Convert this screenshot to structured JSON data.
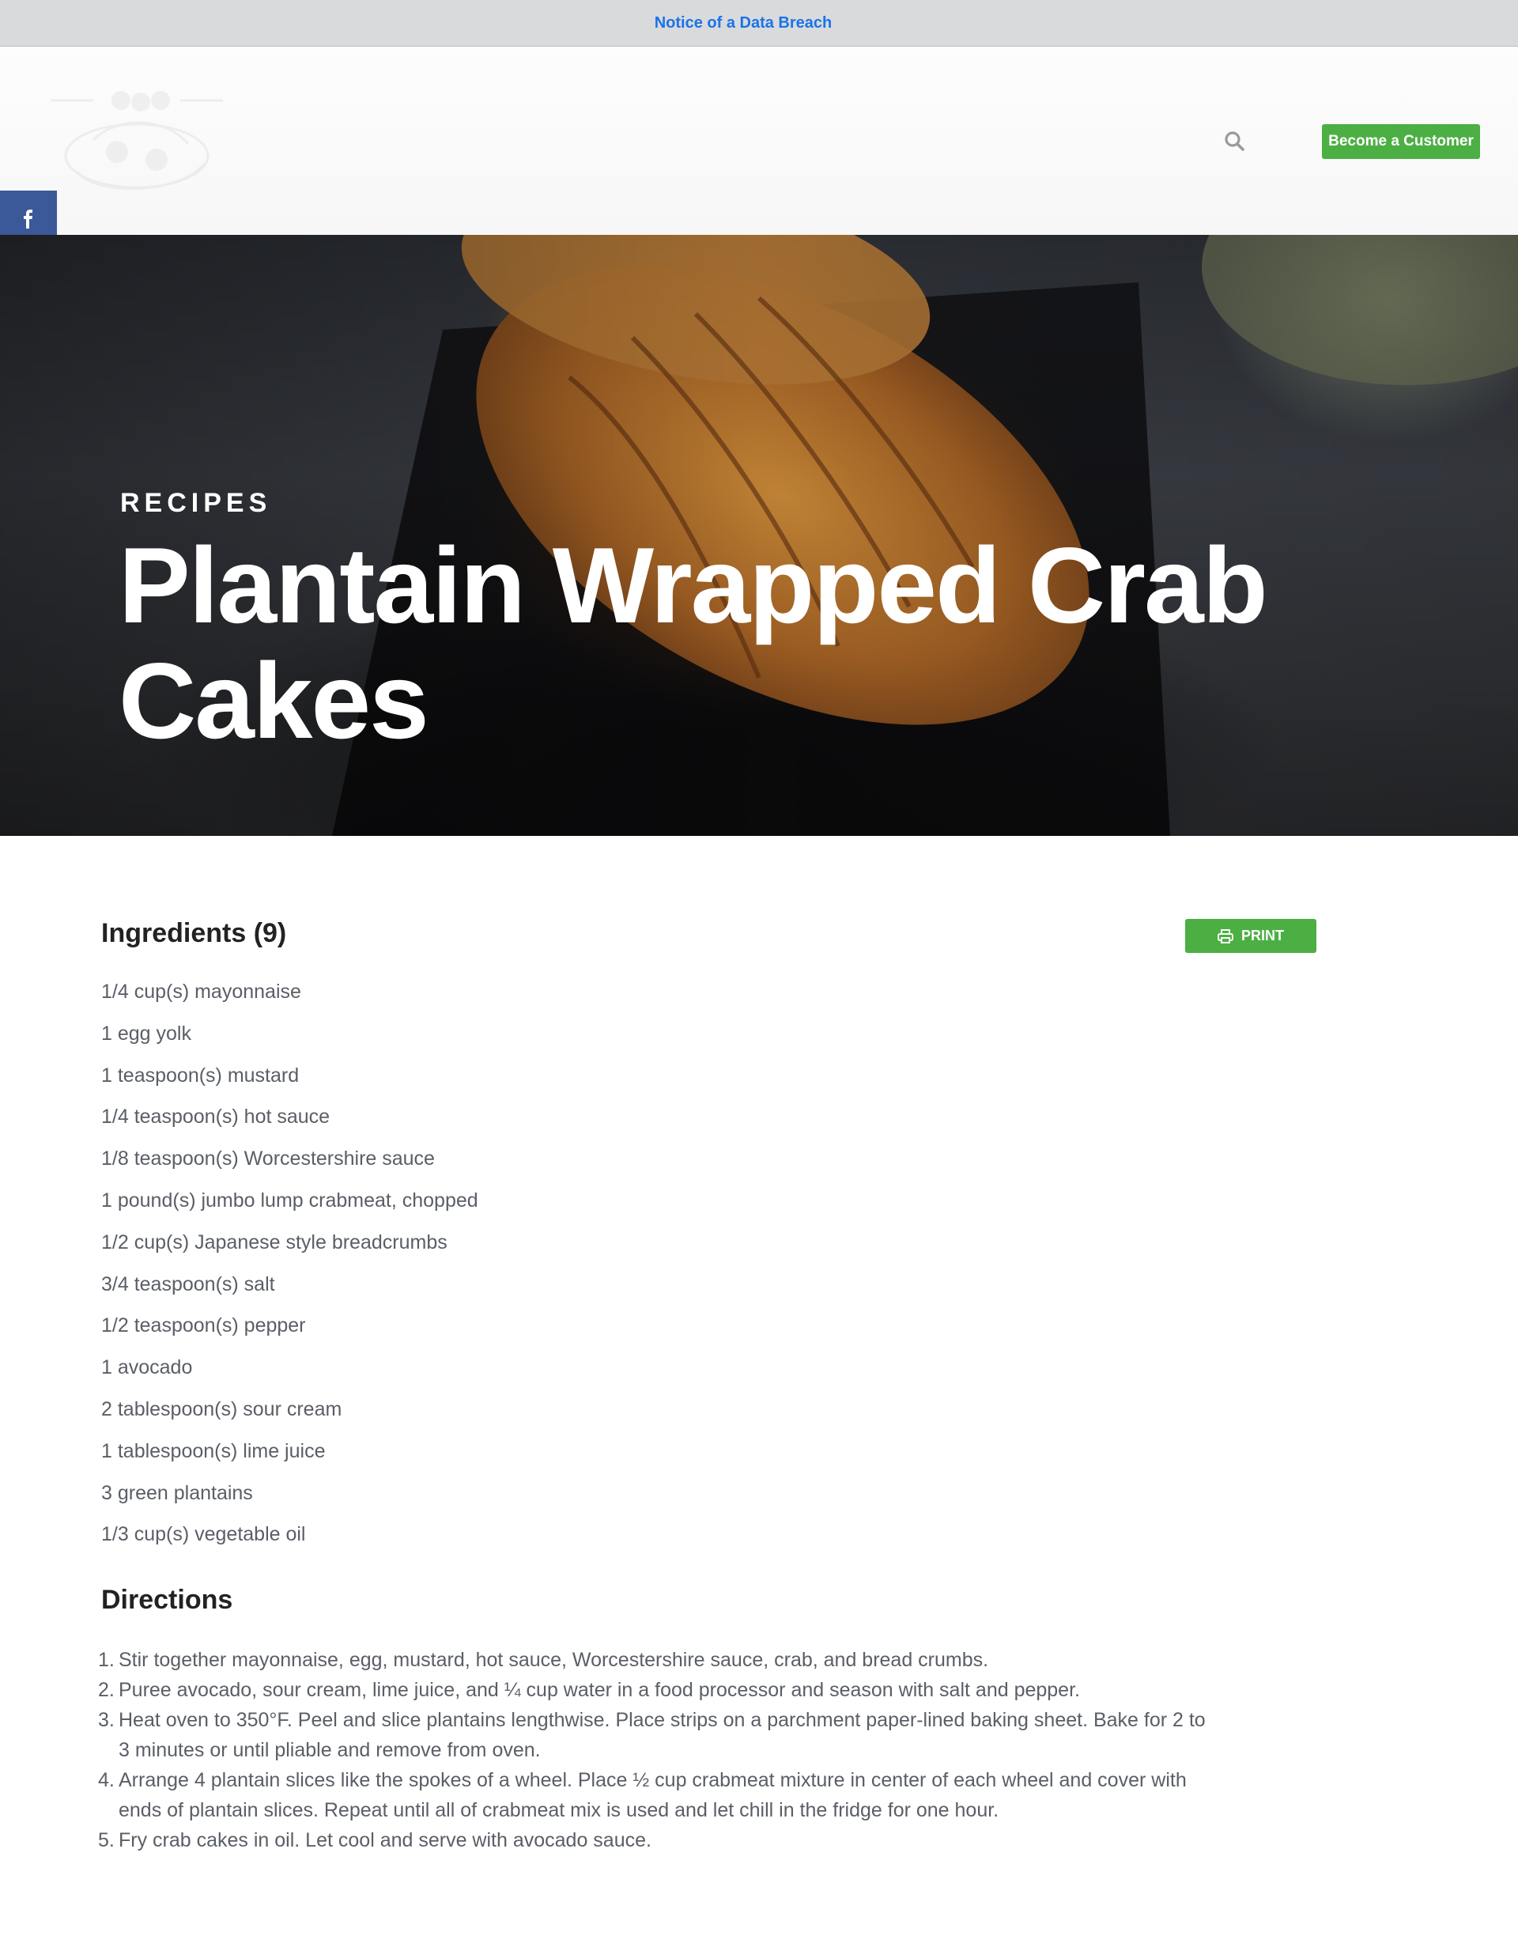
{
  "notice": {
    "text": "Notice of a Data Breach"
  },
  "header": {
    "cta_label": "Become a Customer"
  },
  "social": [
    "facebook-icon",
    "x-icon",
    "pinterest-icon",
    "email-icon",
    "share-icon"
  ],
  "hero": {
    "eyebrow": "RECIPES",
    "title": "Plantain Wrapped Crab Cakes"
  },
  "ingredients": {
    "heading": "Ingredients (9)",
    "print_label": "PRINT",
    "items": [
      "1/4 cup(s) mayonnaise",
      "1 egg yolk",
      "1 teaspoon(s) mustard",
      "1/4 teaspoon(s) hot sauce",
      "1/8 teaspoon(s) Worcestershire sauce",
      "1 pound(s) jumbo lump crabmeat, chopped",
      "1/2 cup(s) Japanese style breadcrumbs",
      "3/4 teaspoon(s) salt",
      "1/2 teaspoon(s) pepper",
      "1 avocado",
      "2 tablespoon(s) sour cream",
      "1 tablespoon(s) lime juice",
      "3 green plantains",
      "1/3 cup(s) vegetable oil"
    ]
  },
  "directions": {
    "heading": "Directions",
    "steps": [
      "Stir together mayonnaise, egg, mustard, hot sauce, Worcestershire sauce, crab, and bread crumbs.",
      "Puree avocado, sour cream, lime juice, and ¼ cup water in a food processor and season with salt and pepper.",
      "Heat oven to 350°F. Peel and slice plantains lengthwise. Place strips on a parchment paper-lined baking sheet. Bake for 2 to 3 minutes or until pliable and remove from oven.",
      "Arrange 4 plantain slices like the spokes of a wheel. Place ½ cup crabmeat mixture in center of each wheel and cover with ends of plantain slices. Repeat until all of crabmeat mix is used and let chill in the fridge for one hour.",
      "Fry crab cakes in oil. Let cool and serve with avocado sauce."
    ]
  }
}
